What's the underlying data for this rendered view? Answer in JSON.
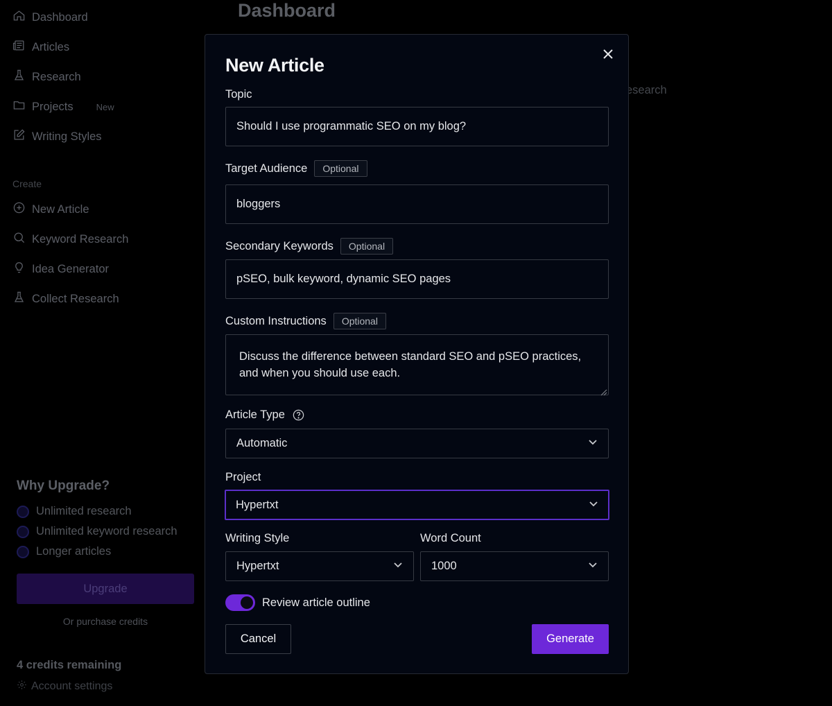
{
  "sidebar": {
    "items": [
      {
        "label": "Dashboard",
        "icon": "home-icon"
      },
      {
        "label": "Articles",
        "icon": "newspaper-icon"
      },
      {
        "label": "Research",
        "icon": "flask-icon"
      },
      {
        "label": "Projects",
        "icon": "folder-icon",
        "badge": "New"
      },
      {
        "label": "Writing Styles",
        "icon": "pencil-square-icon"
      }
    ],
    "create_section_label": "Create",
    "create_items": [
      {
        "label": "New Article",
        "icon": "plus-circle-icon"
      },
      {
        "label": "Keyword Research",
        "icon": "search-icon"
      },
      {
        "label": "Idea Generator",
        "icon": "lightbulb-icon"
      },
      {
        "label": "Collect Research",
        "icon": "flask-icon"
      }
    ],
    "upgrade": {
      "title": "Why Upgrade?",
      "benefits": [
        "Unlimited research",
        "Unlimited keyword research",
        "Longer articles"
      ],
      "button_label": "Upgrade",
      "purchase_link": "Or purchase credits"
    },
    "credits_remaining": "4 credits remaining",
    "account_settings": "Account settings"
  },
  "background": {
    "page_title": "Dashboard",
    "research_fragment": "esearch"
  },
  "modal": {
    "title": "New Article",
    "optional_tag": "Optional",
    "topic": {
      "label": "Topic",
      "value": "Should I use programmatic SEO on my blog?"
    },
    "target_audience": {
      "label": "Target Audience",
      "value": "bloggers"
    },
    "secondary_keywords": {
      "label": "Secondary Keywords",
      "value": "pSEO, bulk keyword, dynamic SEO pages"
    },
    "custom_instructions": {
      "label": "Custom Instructions",
      "value": "Discuss the difference between standard SEO and pSEO practices, and when you should use each."
    },
    "article_type": {
      "label": "Article Type",
      "value": "Automatic"
    },
    "project": {
      "label": "Project",
      "value": "Hypertxt"
    },
    "writing_style": {
      "label": "Writing Style",
      "value": "Hypertxt"
    },
    "word_count": {
      "label": "Word Count",
      "value": "1000"
    },
    "review_outline": {
      "label": "Review article outline",
      "enabled": true
    },
    "cancel_label": "Cancel",
    "generate_label": "Generate"
  },
  "colors": {
    "accent": "#6d28d9",
    "focus_border": "#5b2fc9",
    "modal_bg": "#030712",
    "page_bg": "#000000"
  }
}
